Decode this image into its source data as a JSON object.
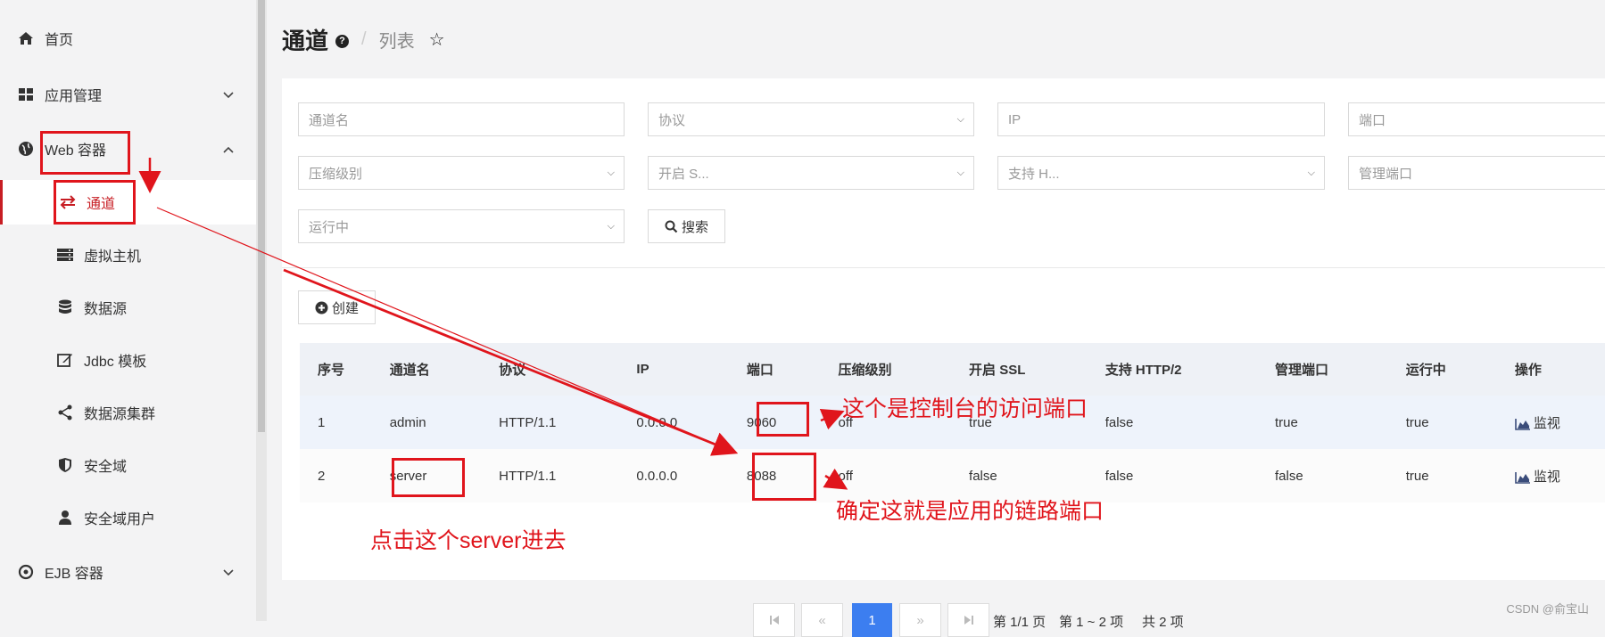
{
  "sidebar": {
    "items": [
      {
        "label": "首页",
        "icon": "home-icon"
      },
      {
        "label": "应用管理",
        "icon": "grid-icon"
      },
      {
        "label": "Web 容器",
        "icon": "globe-icon"
      },
      {
        "label": "EJB 容器",
        "icon": "target-icon"
      }
    ],
    "sub_items": [
      {
        "label": "通道",
        "icon": "transfer-icon"
      },
      {
        "label": "虚拟主机",
        "icon": "server-icon"
      },
      {
        "label": "数据源",
        "icon": "database-icon"
      },
      {
        "label": "Jdbc 模板",
        "icon": "edit-icon"
      },
      {
        "label": "数据源集群",
        "icon": "share-icon"
      },
      {
        "label": "安全域",
        "icon": "shield-icon"
      },
      {
        "label": "安全域用户",
        "icon": "user-icon"
      }
    ]
  },
  "header": {
    "title": "通道",
    "separator": "/",
    "breadcrumb": "列表"
  },
  "filters": {
    "channel_name": "通道名",
    "protocol": "协议",
    "ip": "IP",
    "port": "端口",
    "compression": "压缩级别",
    "ssl": "开启 S...",
    "http2": "支持 H...",
    "admin_port": "管理端口",
    "running": "运行中",
    "search_label": "搜索"
  },
  "toolbar": {
    "create_label": "创建"
  },
  "table": {
    "columns": [
      "序号",
      "通道名",
      "协议",
      "IP",
      "端口",
      "压缩级别",
      "开启 SSL",
      "支持 HTTP/2",
      "管理端口",
      "运行中",
      "操作"
    ],
    "rows": [
      [
        "1",
        "admin",
        "HTTP/1.1",
        "0.0.0.0",
        "9060",
        "off",
        "true",
        "false",
        "true",
        "true",
        "监视"
      ],
      [
        "2",
        "server",
        "HTTP/1.1",
        "0.0.0.0",
        "8088",
        "off",
        "false",
        "false",
        "false",
        "true",
        "监视"
      ]
    ]
  },
  "pagination": {
    "current": "1",
    "page_info": "第 1/1 页",
    "range_info": "第 1 ~ 2 项",
    "total_info": "共 2 项"
  },
  "annotations": {
    "note1": "这个是控制台的访问端口",
    "note2": "确定这就是应用的链路端口",
    "note3": "点击这个server进去"
  },
  "footer": {
    "watermark": "CSDN @俞宝山"
  },
  "colors": {
    "accent": "#c71d23",
    "annotation": "#e0151c",
    "primary": "#3c7ef0"
  }
}
